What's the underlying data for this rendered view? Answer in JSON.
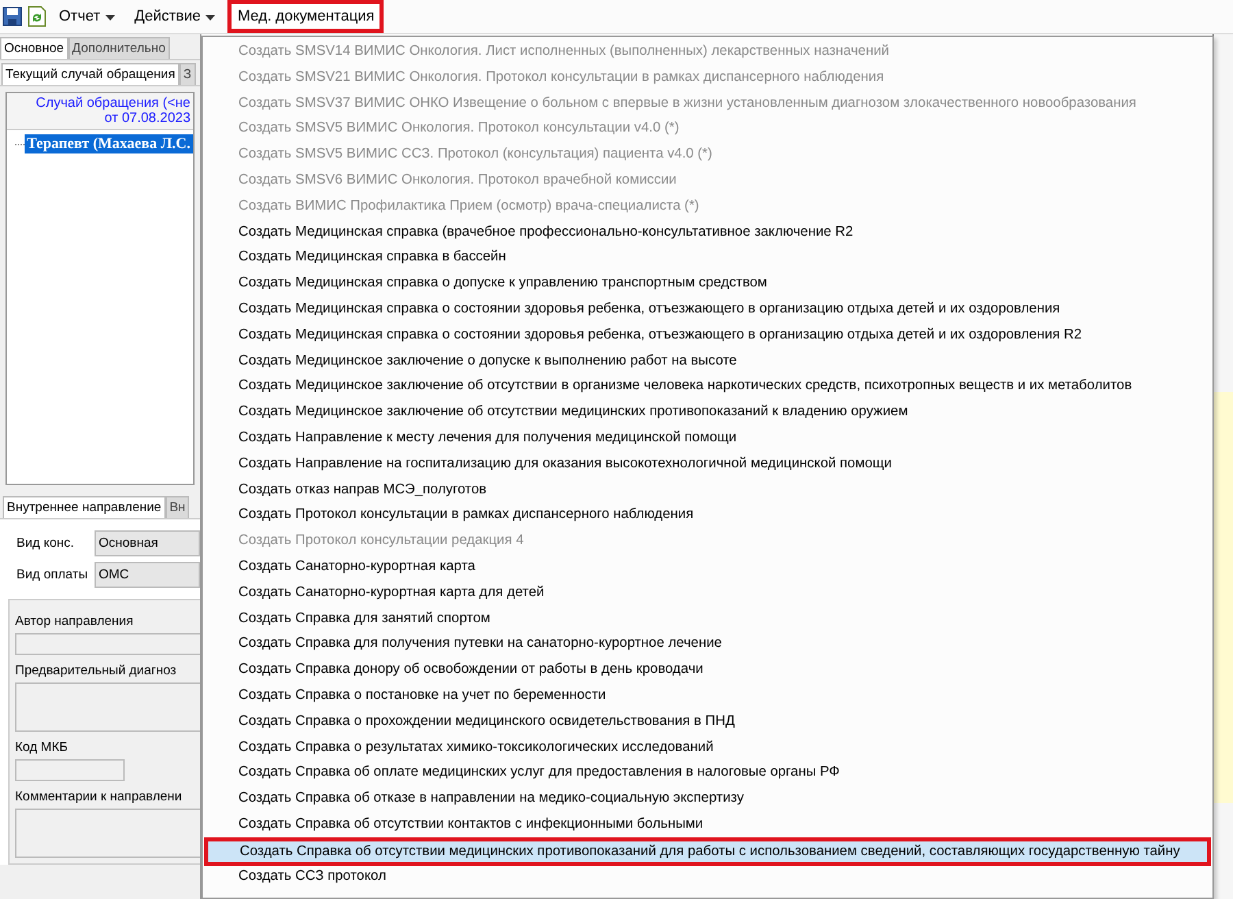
{
  "toolbar": {
    "items": [
      {
        "label": "Отчет",
        "dropdown": true,
        "open": false
      },
      {
        "label": "Действие",
        "dropdown": true,
        "open": false
      },
      {
        "label": "Мед. документация",
        "dropdown": false,
        "open": true
      }
    ]
  },
  "left_panel": {
    "tabs": [
      {
        "label": "Основное",
        "selected": true
      },
      {
        "label": "Дополнительно",
        "selected": false
      }
    ],
    "subtabs": [
      {
        "label": "Текущий случай обращения",
        "selected": true
      },
      {
        "label": "З",
        "selected": false
      }
    ],
    "tree_header": [
      "Случай обращения (<не",
      "от 07.08.2023"
    ],
    "tree": [
      {
        "label": "Терапевт (Махаева Л.С.",
        "selected": true
      }
    ],
    "bottom_tabs": [
      {
        "label": "Внутреннее направление",
        "selected": true
      },
      {
        "label": "Вн",
        "selected": false
      }
    ],
    "selects": [
      {
        "label": "Вид конс.",
        "value": "Основная"
      },
      {
        "label": "Вид оплаты",
        "value": "ОМС"
      }
    ],
    "fields": [
      {
        "label": "Автор направления",
        "kind": "line"
      },
      {
        "label": "Предварительный диагноз",
        "kind": "area"
      },
      {
        "label": "Код МКБ",
        "kind": "short"
      },
      {
        "label": "Комментарии к направлени",
        "kind": "area"
      }
    ]
  },
  "menu": {
    "items": [
      {
        "label": "Создать SMSV14 ВИМИС  Онкология. Лист исполненных (выполненных) лекарственных назначений",
        "disabled": true,
        "selected": false
      },
      {
        "label": "Создать SMSV21 ВИМИС Онкология. Протокол консультации в рамках диспансерного наблюдения",
        "disabled": true,
        "selected": false
      },
      {
        "label": "Создать SMSV37 ВИМИС ОНКО Извещение о больном с впервые в жизни установленным диагнозом злокачественного новообразования",
        "disabled": true,
        "selected": false
      },
      {
        "label": "Создать SMSV5 ВИМИС Онкология. Протокол консультации v4.0 (*)",
        "disabled": true,
        "selected": false
      },
      {
        "label": "Создать SMSV5 ВИМИС ССЗ. Протокол (консультация) пациента v4.0 (*)",
        "disabled": true,
        "selected": false
      },
      {
        "label": "Создать SMSV6 ВИМИС Онкология. Протокол врачебной комиссии",
        "disabled": true,
        "selected": false
      },
      {
        "label": "Создать ВИМИС Профилактика Прием (осмотр) врача-специалиста (*)",
        "disabled": true,
        "selected": false
      },
      {
        "label": "Создать Медицинская справка (врачебное профессионально-консультативное заключение R2",
        "disabled": false,
        "selected": false
      },
      {
        "label": "Создать Медицинская справка в бассейн",
        "disabled": false,
        "selected": false
      },
      {
        "label": "Создать Медицинская справка о допуске к управлению транспортным средством",
        "disabled": false,
        "selected": false
      },
      {
        "label": "Создать Медицинская справка о состоянии здоровья ребенка, отъезжающего в организацию отдыха детей и их оздоровления",
        "disabled": false,
        "selected": false
      },
      {
        "label": "Создать Медицинская справка о состоянии здоровья ребенка, отъезжающего в организацию отдыха детей и их оздоровления R2",
        "disabled": false,
        "selected": false
      },
      {
        "label": "Создать Медицинское заключение о допуске к выполнению работ на высоте",
        "disabled": false,
        "selected": false
      },
      {
        "label": "Создать Медицинское заключение об отсутствии в организме человека наркотических средств, психотропных веществ и их метаболитов",
        "disabled": false,
        "selected": false
      },
      {
        "label": "Создать Медицинское заключение об отсутствии медицинских противопоказаний к владению оружием",
        "disabled": false,
        "selected": false
      },
      {
        "label": "Создать Направление к месту лечения для получения медицинской помощи",
        "disabled": false,
        "selected": false
      },
      {
        "label": "Создать Направление на госпитализацию для оказания высокотехнологичной медицинской помощи",
        "disabled": false,
        "selected": false
      },
      {
        "label": "Создать отказ направ МСЭ_полуготов",
        "disabled": false,
        "selected": false
      },
      {
        "label": "Создать Протокол консультации в рамках диспансерного наблюдения",
        "disabled": false,
        "selected": false
      },
      {
        "label": "Создать Протокол консультации редакция 4",
        "disabled": true,
        "selected": false
      },
      {
        "label": "Создать Санаторно-курортная карта",
        "disabled": false,
        "selected": false
      },
      {
        "label": "Создать Санаторно-курортная карта для детей",
        "disabled": false,
        "selected": false
      },
      {
        "label": "Создать Справка для занятий спортом",
        "disabled": false,
        "selected": false
      },
      {
        "label": "Создать Справка для получения путевки на санаторно-курортное лечение",
        "disabled": false,
        "selected": false
      },
      {
        "label": "Создать Справка донору об освобождении от работы в день кроводачи",
        "disabled": false,
        "selected": false
      },
      {
        "label": "Создать Справка о постановке на учет по беременности",
        "disabled": false,
        "selected": false
      },
      {
        "label": "Создать Справка о прохождении медицинского освидетельствования в ПНД",
        "disabled": false,
        "selected": false
      },
      {
        "label": "Создать Справка о результатах химико-токсикологических исследований",
        "disabled": false,
        "selected": false
      },
      {
        "label": "Создать Справка об оплате медицинских услуг для предоставления в налоговые органы РФ",
        "disabled": false,
        "selected": false
      },
      {
        "label": "Создать Справка об отказе в направлении на медико-социальную экспертизу",
        "disabled": false,
        "selected": false
      },
      {
        "label": "Создать Справка об отсутствии контактов с инфекционными больными",
        "disabled": false,
        "selected": false
      },
      {
        "label": "Создать Справка об отсутствии медицинских противопоказаний для работы с использованием сведений, составляющих государственную тайну",
        "disabled": false,
        "selected": true
      },
      {
        "label": "Создать ССЗ протокол",
        "disabled": false,
        "selected": false
      }
    ]
  }
}
